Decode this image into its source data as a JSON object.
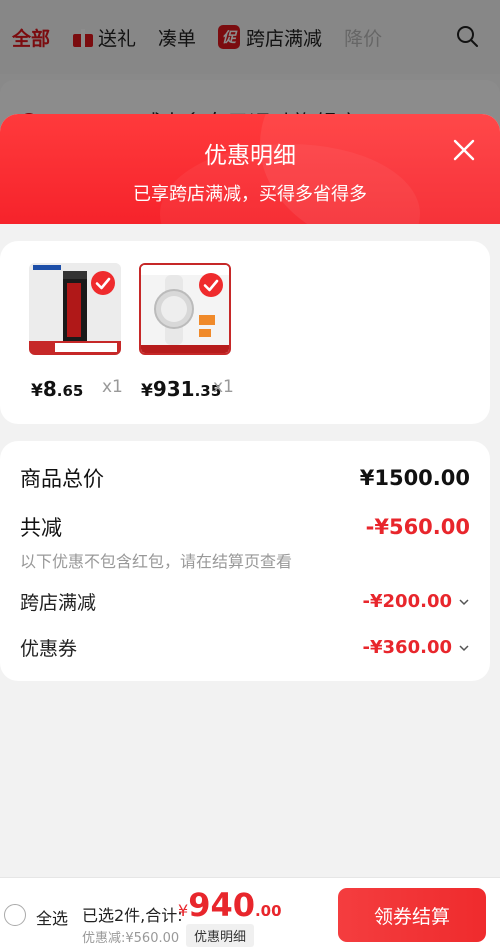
{
  "background": {
    "tabs": [
      {
        "label": "全部",
        "active": true
      },
      {
        "label": "送礼",
        "icon": "gift-icon"
      },
      {
        "label": "凑单"
      },
      {
        "label": "跨店满减",
        "icon": "promo-badge",
        "badge": "促"
      },
      {
        "label": "降价",
        "faded": true
      }
    ],
    "search_icon": "search-icon",
    "store_name": "VICTOR威克多女子运动旗舰店"
  },
  "sheet": {
    "title": "优惠明细",
    "subtitle": "已享跨店满减，买得多省得多",
    "close_icon": "close-icon",
    "products": [
      {
        "price_currency": "¥",
        "price_int": "8",
        "price_dec": ".65",
        "qty": "x1",
        "image": "grip-tape-product"
      },
      {
        "price_currency": "¥",
        "price_int": "931",
        "price_dec": ".35",
        "qty": "x1",
        "image": "watch-product"
      }
    ],
    "summary": {
      "total_label": "商品总价",
      "total_value": "¥1500.00",
      "reduce_label": "共减",
      "reduce_value": "-¥560.00",
      "note": "以下优惠不包含红包，请在结算页查看",
      "items": [
        {
          "label": "跨店满减",
          "value": "-¥200.00"
        },
        {
          "label": "优惠券",
          "value": "-¥360.00"
        }
      ]
    }
  },
  "bottom_bar": {
    "select_all": "全选",
    "selected_text": "已选2件,合计:",
    "total_currency": "¥",
    "total_int": "940",
    "total_dec": ".00",
    "discount_text": "优惠减:¥560.00",
    "detail_button": "优惠明细",
    "checkout_button": "领券结算"
  },
  "colors": {
    "accent": "#e8262c",
    "header": "#f6232b"
  }
}
